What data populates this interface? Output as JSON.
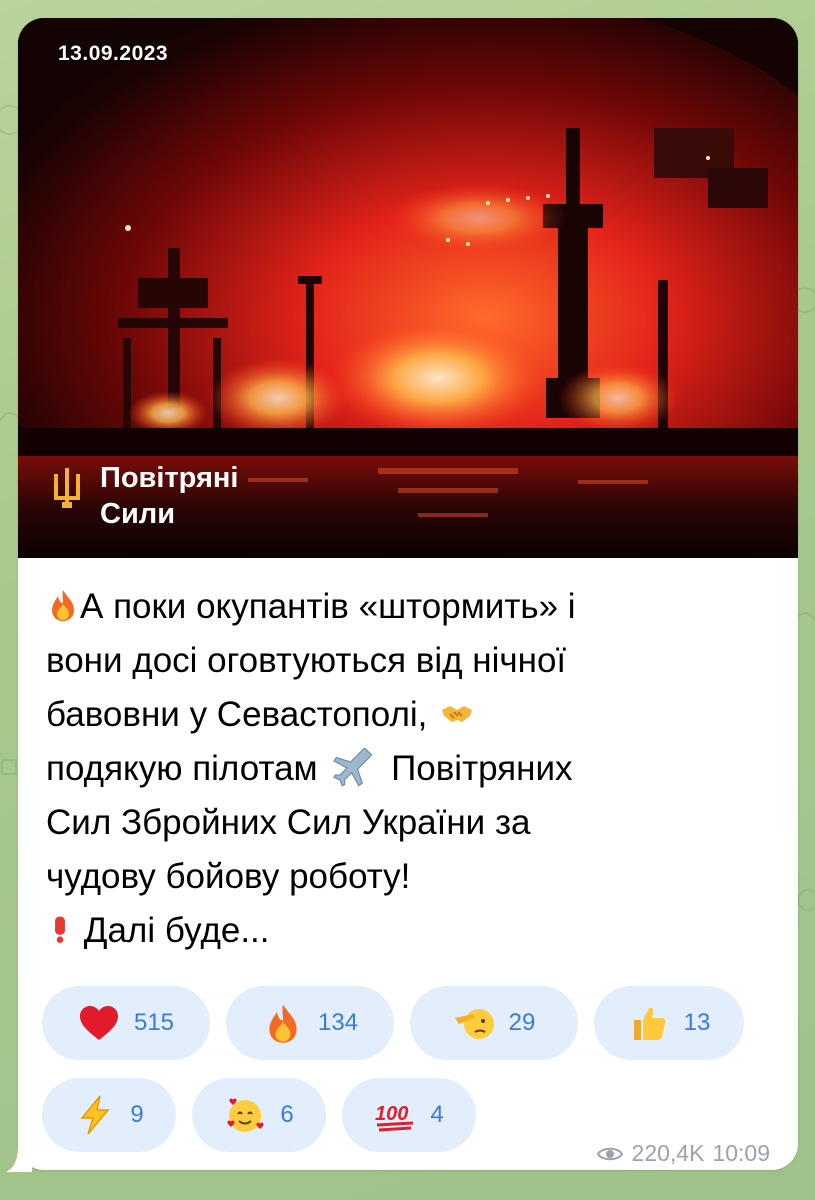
{
  "post": {
    "photo": {
      "date_stamp": "13.09.2023",
      "brand_line1": "Повітряні",
      "brand_line2": "Сили"
    },
    "lines": [
      "А поки окупантів «штормить» і",
      "вони досі оговтуються від нічної",
      "бавовни у Севастополі,",
      "подякую  пілотам",
      "Повітряних",
      "Сил Збройних Сил України за",
      "чудову бойову роботу!",
      "Далі буде..."
    ],
    "inline_icons": [
      "fire-emoji",
      "handshake-emoji",
      "airplane-emoji",
      "exclamation-emoji"
    ]
  },
  "reactions": [
    {
      "icon": "heart-emoji",
      "count": "515"
    },
    {
      "icon": "fire-emoji",
      "count": "134"
    },
    {
      "icon": "salute-emoji",
      "count": "29"
    },
    {
      "icon": "thumbs-up-emoji",
      "count": "13"
    },
    {
      "icon": "lightning-emoji",
      "count": "9"
    },
    {
      "icon": "smiling-hearts-emoji",
      "count": "6"
    },
    {
      "icon": "hundred-emoji",
      "count": "4"
    }
  ],
  "meta": {
    "views": "220,4K",
    "time": "10:09",
    "views_icon": "eye-icon"
  },
  "colors": {
    "background": "#a9c98c",
    "bubble": "#ffffff",
    "reaction_bg": "#e3eefc",
    "reaction_count": "#3a7bd5",
    "meta_text": "#9aa3ad"
  }
}
